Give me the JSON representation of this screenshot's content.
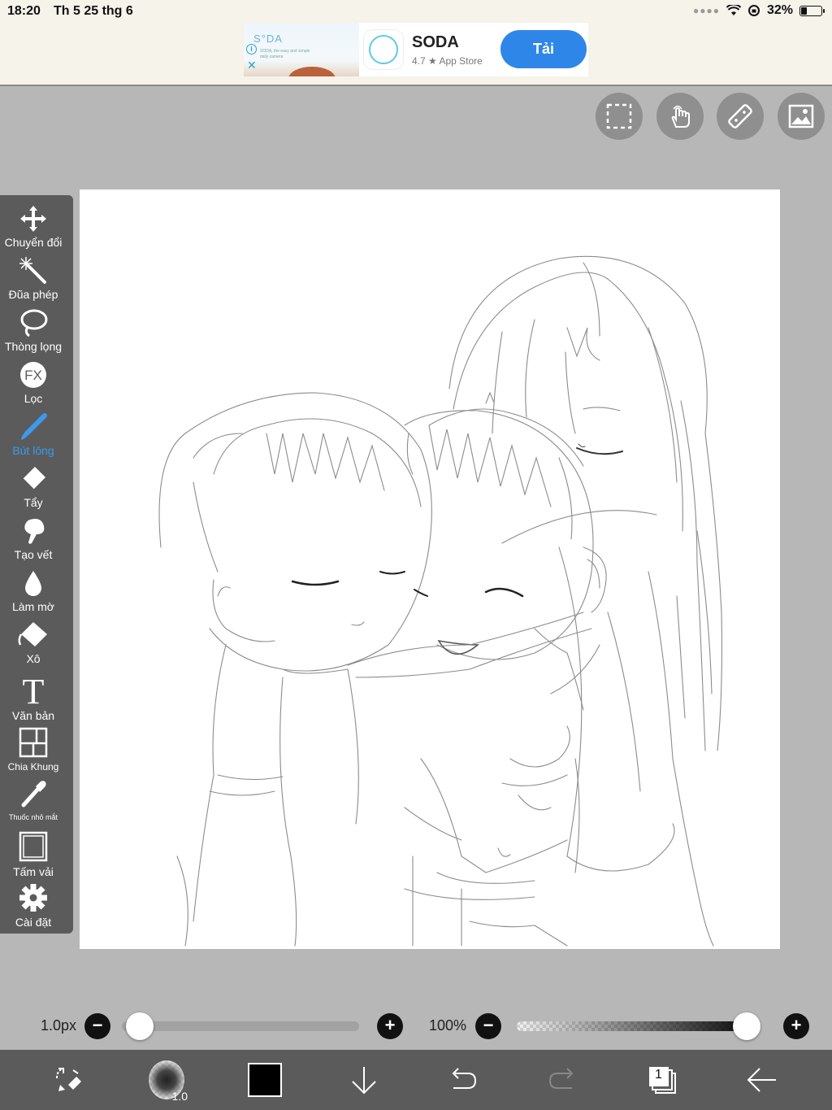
{
  "status_bar": {
    "time": "18:20",
    "date": "Th 5 25 thg 6",
    "battery": "32%",
    "battery_level": 0.32
  },
  "ad": {
    "thumb_brand": "S°DA",
    "thumb_tagline": "SODA, the easy and simple daily camera",
    "title": "SODA",
    "subtitle": "4.7 ★ App Store",
    "button": "Tải"
  },
  "top_tools": [
    "selection-icon",
    "hand-gesture-icon",
    "ruler-icon",
    "image-import-icon"
  ],
  "toolbar": {
    "items": [
      {
        "label": "Chuyển đổi",
        "icon": "move-arrows-icon"
      },
      {
        "label": "Đũa phép",
        "icon": "magic-wand-icon"
      },
      {
        "label": "Thòng lọng",
        "icon": "lasso-icon"
      },
      {
        "label": "Lọc",
        "icon": "fx-filter-icon"
      },
      {
        "label": "Bút lông",
        "icon": "brush-icon",
        "active": true
      },
      {
        "label": "Tẩy",
        "icon": "eraser-icon"
      },
      {
        "label": "Tạo vết",
        "icon": "smudge-icon"
      },
      {
        "label": "Làm mờ",
        "icon": "blur-drop-icon"
      },
      {
        "label": "Xô",
        "icon": "bucket-icon"
      },
      {
        "label": "Văn bản",
        "icon": "text-icon"
      },
      {
        "label": "Chia Khung",
        "icon": "frame-divide-icon"
      },
      {
        "label": "Thuốc nhỏ mắt",
        "icon": "eyedropper-icon"
      },
      {
        "label": "Tấm vải",
        "icon": "canvas-icon"
      },
      {
        "label": "Cài đặt",
        "icon": "gear-icon"
      }
    ],
    "active_color": "#3b9aee"
  },
  "brush": {
    "size_label": "1.0px",
    "size_fraction": 0.02,
    "opacity_label": "100%",
    "opacity_fraction": 1.0,
    "preview_label": "1.0"
  },
  "bottom_bar": {
    "layer_count": "1",
    "current_color": "#000000"
  }
}
